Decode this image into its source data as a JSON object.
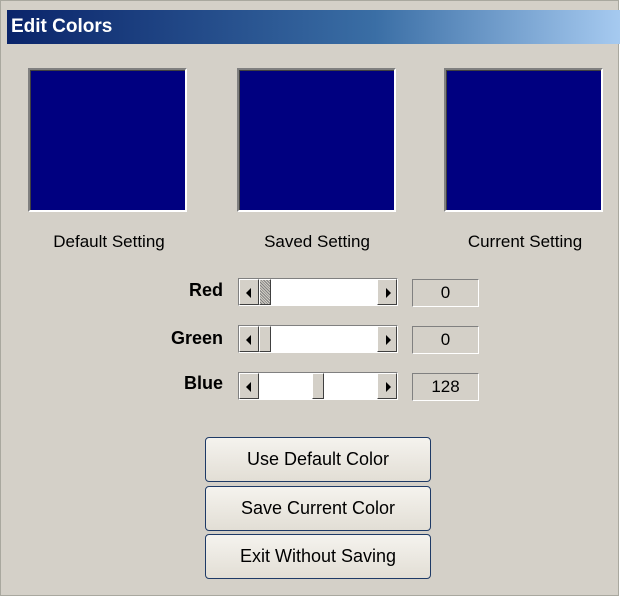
{
  "window": {
    "title": "Edit Colors"
  },
  "swatches": [
    {
      "label": "Default Setting",
      "color": "#000080"
    },
    {
      "label": "Saved Setting",
      "color": "#000080"
    },
    {
      "label": "Current Setting",
      "color": "#000080"
    }
  ],
  "channels": [
    {
      "label": "Red",
      "value": "0",
      "fraction": 0.0
    },
    {
      "label": "Green",
      "value": "0",
      "fraction": 0.0
    },
    {
      "label": "Blue",
      "value": "128",
      "fraction": 0.5
    }
  ],
  "buttons": {
    "use_default": "Use Default Color",
    "save_current": "Save Current Color",
    "exit": "Exit Without Saving"
  },
  "colors": {
    "titlebar_start": "#0a246a",
    "titlebar_end": "#a6caf0",
    "dialog_bg": "#d4d0c8"
  }
}
